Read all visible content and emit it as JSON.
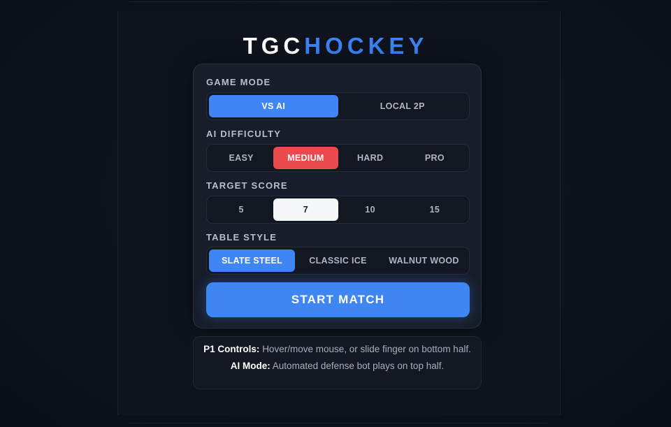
{
  "logo": {
    "part1": "TGC",
    "part2": "HOCKEY",
    "colors": {
      "part1": "#ffffff",
      "part2": "#3d82f2"
    }
  },
  "game_mode": {
    "label": "GAME MODE",
    "options": [
      "VS AI",
      "LOCAL 2P"
    ],
    "selected": "VS AI"
  },
  "ai_difficulty": {
    "label": "AI DIFFICULTY",
    "options": [
      "EASY",
      "MEDIUM",
      "HARD",
      "PRO"
    ],
    "selected": "MEDIUM"
  },
  "target_score": {
    "label": "TARGET SCORE",
    "options": [
      "5",
      "7",
      "10",
      "15"
    ],
    "selected": "7"
  },
  "table_style": {
    "label": "TABLE STYLE",
    "options": [
      "SLATE STEEL",
      "CLASSIC ICE",
      "WALNUT WOOD"
    ],
    "selected": "SLATE STEEL"
  },
  "start_button": "START MATCH",
  "info": {
    "p1_title": "P1 Controls:",
    "p1_text": "Hover/move mouse, or slide finger on bottom half.",
    "ai_title": "AI Mode:",
    "ai_text": "Automated defense bot plays on top half."
  },
  "colors": {
    "accent_blue": "#3f86f4",
    "selected_red": "#ea4a4c",
    "selected_white": "#f6f7f9",
    "background": "#0c1019"
  }
}
